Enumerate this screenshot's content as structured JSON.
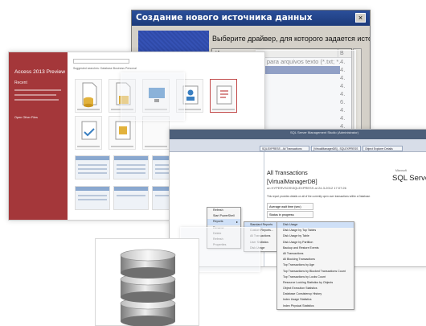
{
  "odbc_dialog": {
    "title": "Создание нового источника данных",
    "close_label": "×",
    "prompt": "Выберите драйвер, для которого задается источник.",
    "column_name": "Имя",
    "column_version": "В",
    "drivers": [
      {
        "name": "Driver da Microsoft para arquivos texto (*.txt; *.csv)",
        "version": "4.",
        "selected": false
      },
      {
        "name": "cess (*.mdb)",
        "version": "4.",
        "selected": true
      },
      {
        "name": "ase (*.dbf)",
        "version": "4.",
        "selected": false
      },
      {
        "name": "cel(*.xls)",
        "version": "4.",
        "selected": false
      },
      {
        "name": "radox (*.db )",
        "version": "4.",
        "selected": false
      },
      {
        "name": "t Visual FoxPro",
        "version": "6.",
        "selected": false
      },
      {
        "name": "iver (*.mdb)",
        "version": "4.",
        "selected": false
      },
      {
        "name": "iver (*.dbf)",
        "version": "4.",
        "selected": false
      },
      {
        "name": "iver (*.xls)",
        "version": "4.",
        "selected": false
      },
      {
        "name": "iver (*.dbf)",
        "version": "4.",
        "selected": false
      }
    ]
  },
  "access": {
    "title": "Access 2013 Preview",
    "recent_label": "Recent",
    "open_other": "Open Other Files",
    "template_search": "Search for online templates",
    "subline": "Suggested searches: Database    Business    Personal"
  },
  "sql": {
    "window_title": "SQL Server Management Studio (Administrator)",
    "tabs": [
      "SQLEXPRESS - All Transactions",
      "[VirtualManagerDB] - SQLEXPRESS",
      "Object Explorer Details"
    ],
    "report_title": "All Transactions",
    "db_name": "[VirtualManagerDB]",
    "server_line": "on HYPERVSOS\\SQLEXPRESS at 24-3-2012 17:07:26",
    "description": "This report provides details on all of the currently open user transactions within a Database.",
    "table_rows": [
      "Average wait time (sec)",
      "Status in progress"
    ],
    "logo_vendor": "Microsoft",
    "logo_text": "SQL Server",
    "menu_primary": [
      {
        "label": "Refresh",
        "arrow": false,
        "highlight": false
      },
      {
        "label": "Start PowerShell",
        "arrow": false,
        "highlight": false
      },
      {
        "label": "Reports",
        "arrow": true,
        "highlight": true
      },
      {
        "label": "Rename",
        "arrow": false,
        "highlight": false
      },
      {
        "label": "Delete",
        "arrow": false,
        "highlight": false
      },
      {
        "label": "Refresh",
        "arrow": false,
        "highlight": false
      },
      {
        "label": "Properties",
        "arrow": false,
        "highlight": false
      }
    ],
    "menu_reports": [
      {
        "label": "Standard Reports",
        "arrow": true,
        "highlight": true
      },
      {
        "label": "Custom Reports...",
        "arrow": false,
        "highlight": false
      },
      {
        "label": "All Transactions",
        "arrow": false,
        "highlight": false
      },
      {
        "label": "User Statistics",
        "arrow": false,
        "highlight": false
      },
      {
        "label": "Disk Usage",
        "arrow": false,
        "highlight": false
      }
    ],
    "menu_standard": [
      {
        "label": "Disk Usage",
        "highlight": true
      },
      {
        "label": "Disk Usage by Top Tables",
        "highlight": false
      },
      {
        "label": "Disk Usage by Table",
        "highlight": false
      },
      {
        "label": "Disk Usage by Partition",
        "highlight": false
      },
      {
        "label": "Backup and Restore Events",
        "highlight": false
      },
      {
        "label": "All Transactions",
        "highlight": false
      },
      {
        "label": "All Blocking Transactions",
        "highlight": false
      },
      {
        "label": "Top Transactions by Age",
        "highlight": false
      },
      {
        "label": "Top Transactions by Blocked Transactions Count",
        "highlight": false
      },
      {
        "label": "Top Transactions by Locks Count",
        "highlight": false
      },
      {
        "label": "Resource Locking Statistics by Objects",
        "highlight": false
      },
      {
        "label": "Object Execution Statistics",
        "highlight": false
      },
      {
        "label": "Database Consistency History",
        "highlight": false
      },
      {
        "label": "Index Usage Statistics",
        "highlight": false
      },
      {
        "label": "Index Physical Statistics",
        "highlight": false
      }
    ]
  },
  "colors": {
    "access_red": "#a4373a",
    "odbc_titlebar": "#1c3a7a",
    "odbc_selection": "#1f3f8f",
    "sql_header": "#4d5f7a"
  }
}
